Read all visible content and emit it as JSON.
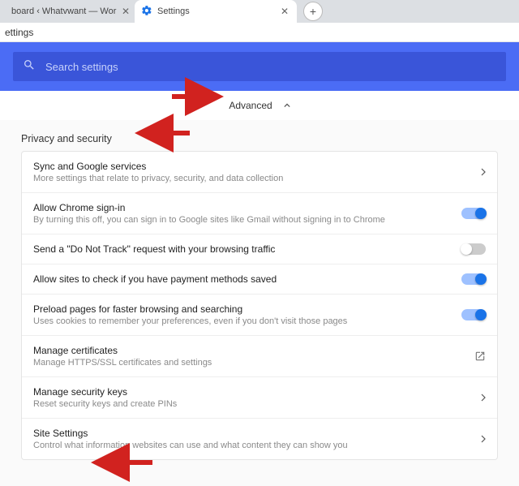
{
  "tabs": {
    "inactive": {
      "label": "board ‹ Whatvwant — Wor"
    },
    "active": {
      "label": "Settings"
    }
  },
  "page_subtitle": "ettings",
  "search": {
    "placeholder": "Search settings"
  },
  "advanced_label": "Advanced",
  "section_title": "Privacy and security",
  "rows": [
    {
      "title": "Sync and Google services",
      "sub": "More settings that relate to privacy, security, and data collection",
      "affordance": "chevron"
    },
    {
      "title": "Allow Chrome sign-in",
      "sub": "By turning this off, you can sign in to Google sites like Gmail without signing in to Chrome",
      "affordance": "toggle",
      "on": true
    },
    {
      "title": "Send a \"Do Not Track\" request with your browsing traffic",
      "sub": "",
      "affordance": "toggle",
      "on": false
    },
    {
      "title": "Allow sites to check if you have payment methods saved",
      "sub": "",
      "affordance": "toggle",
      "on": true
    },
    {
      "title": "Preload pages for faster browsing and searching",
      "sub": "Uses cookies to remember your preferences, even if you don't visit those pages",
      "affordance": "toggle",
      "on": true
    },
    {
      "title": "Manage certificates",
      "sub": "Manage HTTPS/SSL certificates and settings",
      "affordance": "external"
    },
    {
      "title": "Manage security keys",
      "sub": "Reset security keys and create PINs",
      "affordance": "chevron"
    },
    {
      "title": "Site Settings",
      "sub": "Control what information websites can use and what content they can show you",
      "affordance": "chevron"
    }
  ],
  "colors": {
    "accent": "#1a73e8",
    "heroBg": "#4b6cf5",
    "arrow": "#d1221f"
  }
}
